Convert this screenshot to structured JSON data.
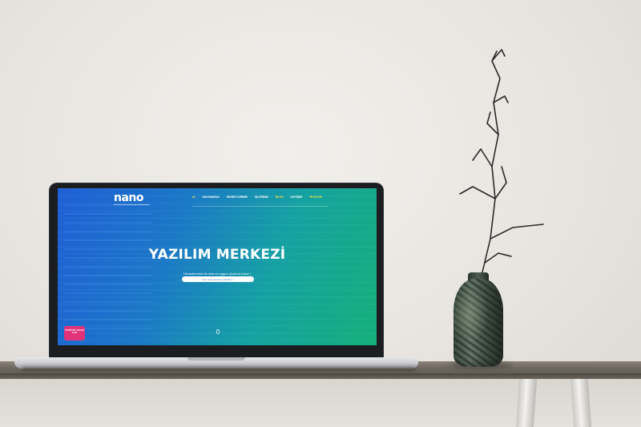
{
  "screen": {
    "logo_text": "nano",
    "nav_items": [
      "AI",
      "HAKKIMIZDA",
      "HİZMETLERİMİZ",
      "İŞLERİMİZ",
      "BLOG",
      "İLETİŞİM",
      "TR EN DE"
    ],
    "hero_title": "YAZILIM MERKEZİ",
    "hero_subtitle": "Hizmetlerimizi ile size en uygun çözümü bulun !",
    "hero_button": "Size nasıl yardımcı olabiliriz ?",
    "promo_badge": "ÜCRETSİZ TEKLİF ALIN"
  },
  "colors": {
    "wall": "#e9e6e1",
    "screen_start": "#1f5fd6",
    "screen_end": "#15b07a",
    "nav_active": "#f5e048",
    "promo_badge": "#e2327a",
    "vase": "#4f5d52"
  }
}
